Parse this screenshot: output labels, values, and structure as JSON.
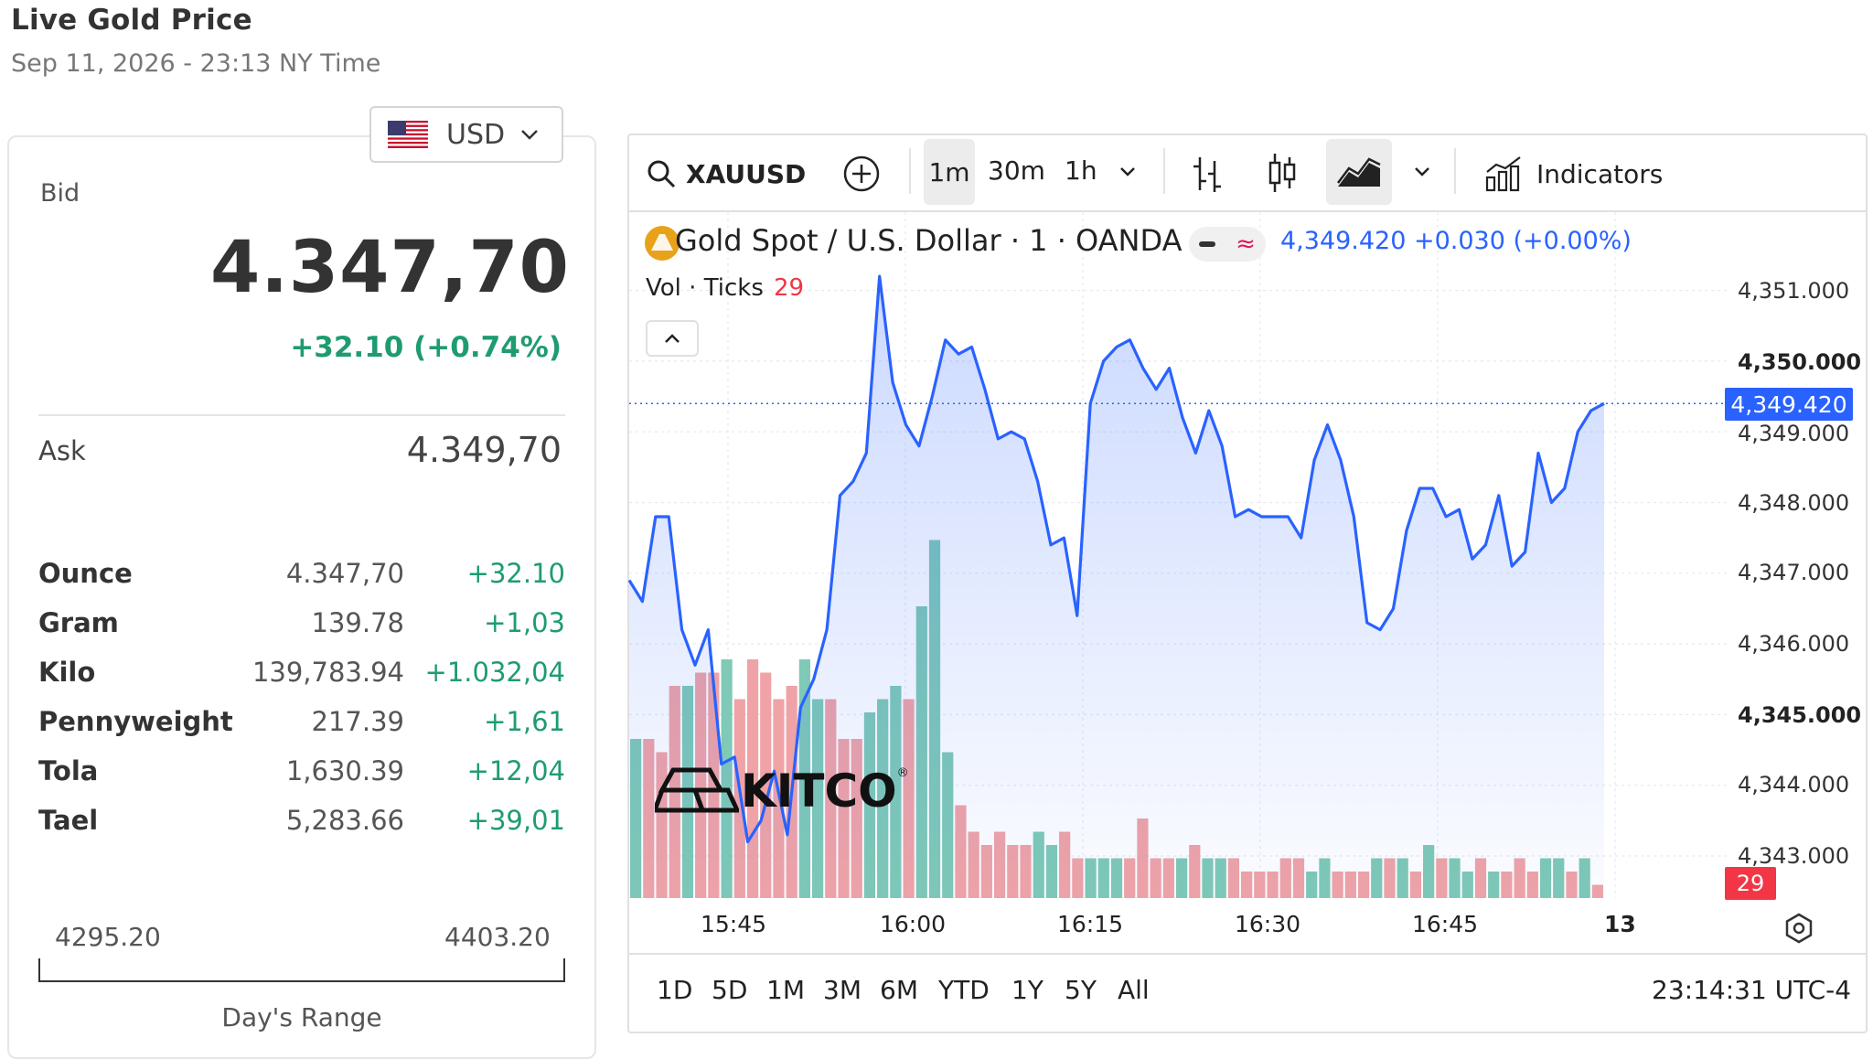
{
  "header": {
    "title": "Live Gold Price",
    "subtitle": "Sep 11, 2026 - 23:13 NY Time"
  },
  "currency": {
    "code": "USD",
    "flag_icon": "us-flag-icon"
  },
  "quote": {
    "bid_label": "Bid",
    "bid": "4.347,70",
    "change": "+32.10 (+0.74%)",
    "ask_label": "Ask",
    "ask": "4.349,70"
  },
  "units": [
    {
      "name": "Ounce",
      "value": "4.347,70",
      "change": "+32.10"
    },
    {
      "name": "Gram",
      "value": "139.78",
      "change": "+1,03"
    },
    {
      "name": "Kilo",
      "value": "139,783.94",
      "change": "+1.032,04"
    },
    {
      "name": "Pennyweight",
      "value": "217.39",
      "change": "+1,61"
    },
    {
      "name": "Tola",
      "value": "1,630.39",
      "change": "+12,04"
    },
    {
      "name": "Tael",
      "value": "5,283.66",
      "change": "+39,01"
    }
  ],
  "day_range": {
    "low": "4295.20",
    "high": "4403.20",
    "label": "Day's Range"
  },
  "toolbar": {
    "symbol": "XAUUSD",
    "intervals": [
      "1m",
      "30m",
      "1h"
    ],
    "active_interval": "1m",
    "indicators_label": "Indicators"
  },
  "legend": {
    "symbol_text": "Gold Spot / U.S. Dollar · 1 · OANDA",
    "price_text": "4,349.420 +0.030 (+0.00%)",
    "vol_label": "Vol · Ticks",
    "vol_count": "29"
  },
  "watermark": {
    "brand": "KITCO"
  },
  "ranges": [
    "1D",
    "5D",
    "1M",
    "3M",
    "6M",
    "YTD",
    "1Y",
    "5Y",
    "All"
  ],
  "clock": "23:14:31 UTC-4",
  "colors": {
    "line": "#2962ff",
    "up": "#1f9c6f",
    "vol_up": "#7fc9b6",
    "vol_down": "#f0a3a6",
    "price_tag": "#2962ff",
    "vol_tag": "#f23645"
  },
  "chart_data": {
    "type": "area",
    "x_axis_labels": [
      "15:45",
      "16:00",
      "16:15",
      "16:30",
      "16:45",
      "13"
    ],
    "y_axis_labels": [
      "4,351.000",
      "4,350.000",
      "4,349.000",
      "4,348.000",
      "4,347.000",
      "4,346.000",
      "4,345.000",
      "4,344.000",
      "4,343.000"
    ],
    "ylim": [
      4342.4,
      4351.3
    ],
    "last_price_label": "4,349.420",
    "volume_tag": "29",
    "series": [
      {
        "values": [
          4346.9,
          4346.6,
          4347.8,
          4347.8,
          4346.2,
          4345.7,
          4346.2,
          4344.3,
          4344.4,
          4343.2,
          4343.5,
          4344.2,
          4343.3,
          4345.1,
          4345.5,
          4346.2,
          4348.1,
          4348.3,
          4348.7,
          4351.2,
          4349.7,
          4349.1,
          4348.8,
          4349.5,
          4350.3,
          4350.1,
          4350.2,
          4349.6,
          4348.9,
          4349.0,
          4348.9,
          4348.3,
          4347.4,
          4347.5,
          4346.4,
          4349.4,
          4350.0,
          4350.2,
          4350.3,
          4349.9,
          4349.6,
          4349.9,
          4349.2,
          4348.7,
          4349.3,
          4348.8,
          4347.8,
          4347.9,
          4347.8,
          4347.8,
          4347.8,
          4347.5,
          4348.6,
          4349.1,
          4348.6,
          4347.8,
          4346.3,
          4346.2,
          4346.5,
          4347.6,
          4348.2,
          4348.2,
          4347.8,
          4347.9,
          4347.2,
          4347.4,
          4348.1,
          4347.1,
          4347.3,
          4348.7,
          4348.0,
          4348.2,
          4349.0,
          4349.3,
          4349.4
        ]
      }
    ],
    "volume": [
      {
        "v": 12,
        "up": true
      },
      {
        "v": 12,
        "up": false
      },
      {
        "v": 11,
        "up": false
      },
      {
        "v": 16,
        "up": false
      },
      {
        "v": 16,
        "up": true
      },
      {
        "v": 17,
        "up": false
      },
      {
        "v": 17,
        "up": false
      },
      {
        "v": 18,
        "up": true
      },
      {
        "v": 15,
        "up": false
      },
      {
        "v": 18,
        "up": false
      },
      {
        "v": 17,
        "up": false
      },
      {
        "v": 15,
        "up": false
      },
      {
        "v": 16,
        "up": false
      },
      {
        "v": 18,
        "up": true
      },
      {
        "v": 15,
        "up": true
      },
      {
        "v": 15,
        "up": false
      },
      {
        "v": 12,
        "up": false
      },
      {
        "v": 12,
        "up": false
      },
      {
        "v": 14,
        "up": true
      },
      {
        "v": 15,
        "up": true
      },
      {
        "v": 16,
        "up": true
      },
      {
        "v": 15,
        "up": false
      },
      {
        "v": 22,
        "up": true
      },
      {
        "v": 27,
        "up": true
      },
      {
        "v": 11,
        "up": true
      },
      {
        "v": 7,
        "up": false
      },
      {
        "v": 5,
        "up": false
      },
      {
        "v": 4,
        "up": false
      },
      {
        "v": 5,
        "up": false
      },
      {
        "v": 4,
        "up": false
      },
      {
        "v": 4,
        "up": false
      },
      {
        "v": 5,
        "up": true
      },
      {
        "v": 4,
        "up": true
      },
      {
        "v": 5,
        "up": false
      },
      {
        "v": 3,
        "up": false
      },
      {
        "v": 3,
        "up": true
      },
      {
        "v": 3,
        "up": true
      },
      {
        "v": 3,
        "up": true
      },
      {
        "v": 3,
        "up": false
      },
      {
        "v": 6,
        "up": false
      },
      {
        "v": 3,
        "up": false
      },
      {
        "v": 3,
        "up": false
      },
      {
        "v": 3,
        "up": true
      },
      {
        "v": 4,
        "up": false
      },
      {
        "v": 3,
        "up": true
      },
      {
        "v": 3,
        "up": true
      },
      {
        "v": 3,
        "up": false
      },
      {
        "v": 2,
        "up": false
      },
      {
        "v": 2,
        "up": false
      },
      {
        "v": 2,
        "up": false
      },
      {
        "v": 3,
        "up": false
      },
      {
        "v": 3,
        "up": false
      },
      {
        "v": 2,
        "up": true
      },
      {
        "v": 3,
        "up": true
      },
      {
        "v": 2,
        "up": false
      },
      {
        "v": 2,
        "up": false
      },
      {
        "v": 2,
        "up": false
      },
      {
        "v": 3,
        "up": true
      },
      {
        "v": 3,
        "up": false
      },
      {
        "v": 3,
        "up": true
      },
      {
        "v": 2,
        "up": false
      },
      {
        "v": 4,
        "up": true
      },
      {
        "v": 3,
        "up": false
      },
      {
        "v": 3,
        "up": true
      },
      {
        "v": 2,
        "up": true
      },
      {
        "v": 3,
        "up": false
      },
      {
        "v": 2,
        "up": true
      },
      {
        "v": 2,
        "up": false
      },
      {
        "v": 3,
        "up": false
      },
      {
        "v": 2,
        "up": false
      },
      {
        "v": 3,
        "up": true
      },
      {
        "v": 3,
        "up": true
      },
      {
        "v": 2,
        "up": false
      },
      {
        "v": 3,
        "up": true
      },
      {
        "v": 1,
        "up": false
      }
    ]
  }
}
